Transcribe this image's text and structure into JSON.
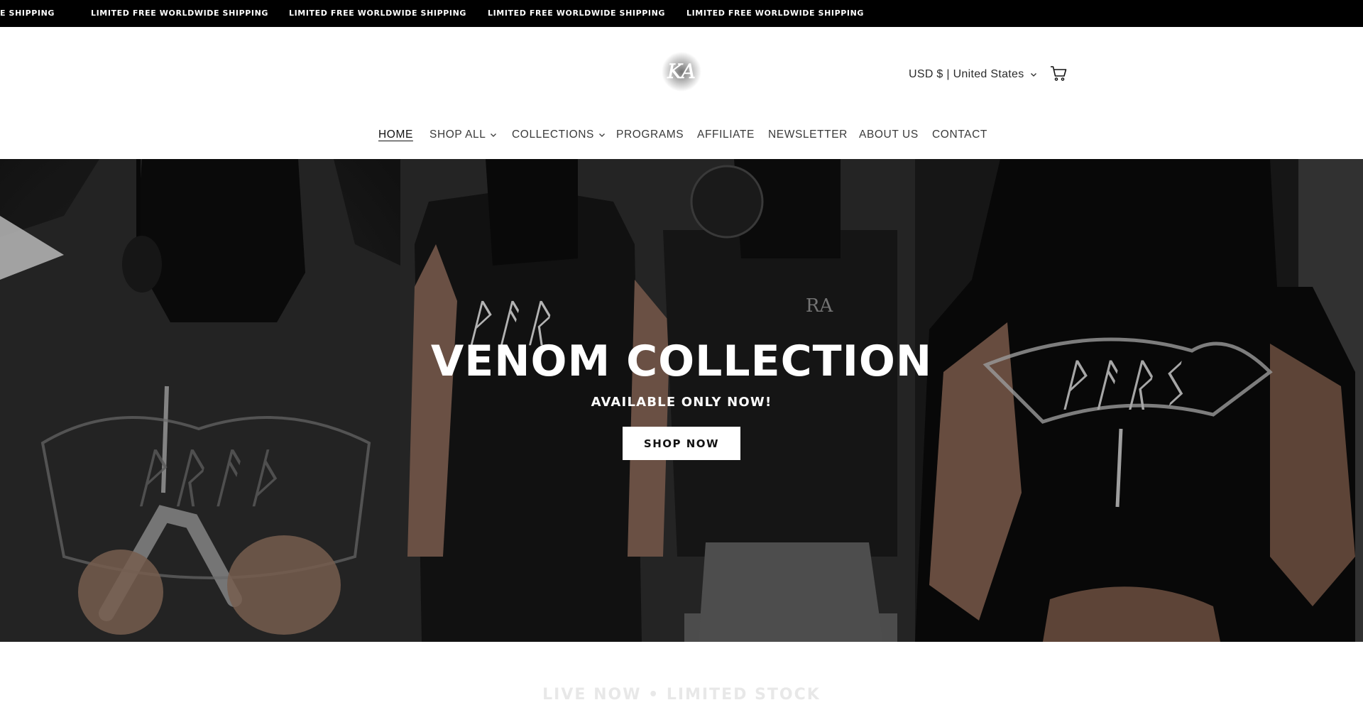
{
  "announcement": {
    "messages": [
      "E SHIPPING",
      "LIMITED FREE WORLDWIDE SHIPPING",
      "LIMITED FREE WORLDWIDE SHIPPING",
      "LIMITED FREE WORLDWIDE SHIPPING",
      "LIMITED FREE WORLDWIDE SHIPPING"
    ]
  },
  "header": {
    "logo_text": "KA",
    "locale_label": "USD $ | United States",
    "cart_icon": "cart-icon"
  },
  "nav": {
    "items": [
      {
        "label": "HOME",
        "active": true,
        "has_dropdown": false
      },
      {
        "label": "SHOP ALL",
        "active": false,
        "has_dropdown": true
      },
      {
        "label": "COLLECTIONS",
        "active": false,
        "has_dropdown": true
      },
      {
        "label": "PROGRAMS",
        "active": false,
        "has_dropdown": false
      },
      {
        "label": "AFFILIATE",
        "active": false,
        "has_dropdown": false
      },
      {
        "label": "NEWSLETTER",
        "active": false,
        "has_dropdown": false
      },
      {
        "label": "ABOUT US",
        "active": false,
        "has_dropdown": false
      },
      {
        "label": "CONTACT",
        "active": false,
        "has_dropdown": false
      }
    ]
  },
  "hero": {
    "title": "VENOM COLLECTION",
    "subtitle": "AVAILABLE ONLY NOW!",
    "button_label": "SHOP NOW"
  },
  "below": {
    "heading": "LIVE NOW • LIMITED STOCK"
  },
  "colors": {
    "announcement_bg": "#000000",
    "button_bg": "#ffffff",
    "text_dark": "#121212"
  }
}
